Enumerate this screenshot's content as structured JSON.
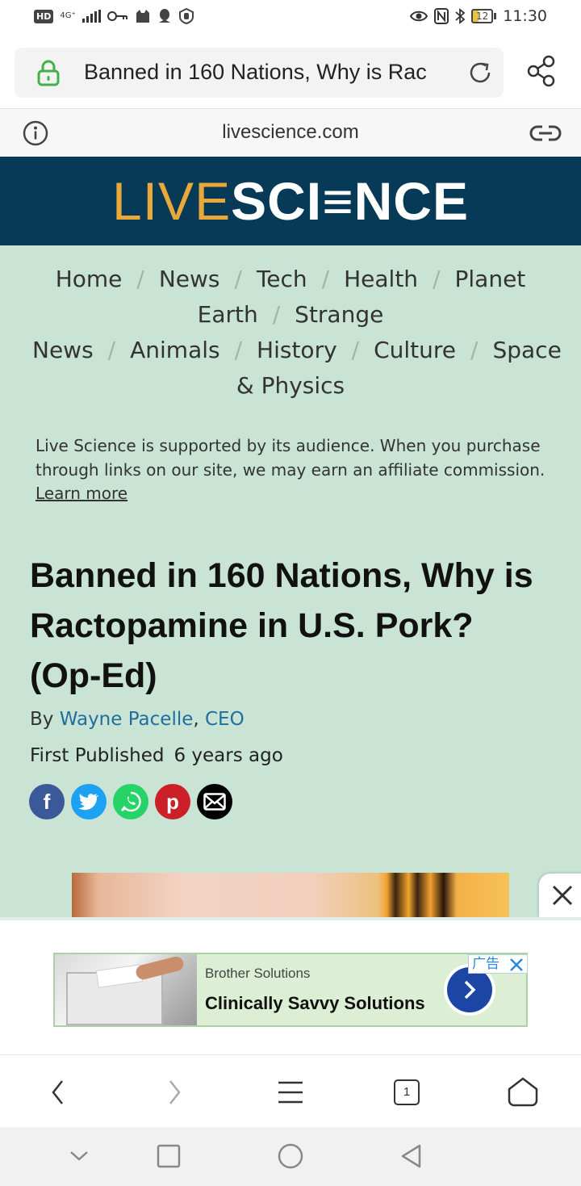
{
  "status_bar": {
    "hd_label": "HD",
    "network_label": "4G⁺",
    "time": "11:30",
    "battery_level": "12",
    "battery_fraction": 0.12,
    "left_icons": [
      "hd-icon",
      "signal-icon",
      "key-icon",
      "cat-app-icon",
      "qq-icon",
      "shield-hand-icon"
    ],
    "right_icons": [
      "eye-icon",
      "nfc-icon",
      "bluetooth-icon",
      "battery-icon"
    ]
  },
  "browser": {
    "url_title": "Banned in 160 Nations, Why is Rac",
    "domain": "livescience.com",
    "tab_count": "1",
    "icons": {
      "lock": "lock-icon",
      "reload": "reload-icon",
      "share": "share-icon",
      "info": "info-icon",
      "link": "link-icon"
    }
  },
  "site": {
    "logo_live": "LIVE",
    "logo_science": "SCI≡NCE",
    "colors": {
      "header_bg": "#073a57",
      "logo_accent": "#e8a83a",
      "content_bg": "#c9e3d4",
      "link": "#1f6e9e"
    },
    "nav_separator": "/",
    "nav": [
      {
        "label": "Home"
      },
      {
        "label": "News"
      },
      {
        "label": "Tech"
      },
      {
        "label": "Health"
      },
      {
        "label": "Planet Earth"
      },
      {
        "label": "Strange News"
      },
      {
        "label": "Animals"
      },
      {
        "label": "History"
      },
      {
        "label": "Culture"
      },
      {
        "label": "Space & Physics"
      }
    ]
  },
  "article": {
    "affiliate_text": "Live Science is supported by its audience. When you purchase through links on our site, we may earn an affiliate commission.",
    "affiliate_link": "Learn more",
    "headline": "Banned in 160 Nations, Why is Ractopamine in U.S. Pork? (Op-Ed)",
    "byline_prefix": "By",
    "author": "Wayne Pacelle",
    "author_comma": ",",
    "author_role": "CEO",
    "published_label": "First Published",
    "published_value": "6 years ago",
    "share_buttons": [
      {
        "glyph": "f",
        "icon": "facebook-icon"
      },
      {
        "glyph": "",
        "icon": "twitter-icon"
      },
      {
        "glyph": "",
        "icon": "whatsapp-icon"
      },
      {
        "glyph": "p",
        "icon": "pinterest-icon"
      },
      {
        "glyph": "",
        "icon": "email-icon"
      }
    ]
  },
  "ad": {
    "brand": "Brother Solutions",
    "headline": "Clinically Savvy Solutions",
    "tag": "广告"
  }
}
